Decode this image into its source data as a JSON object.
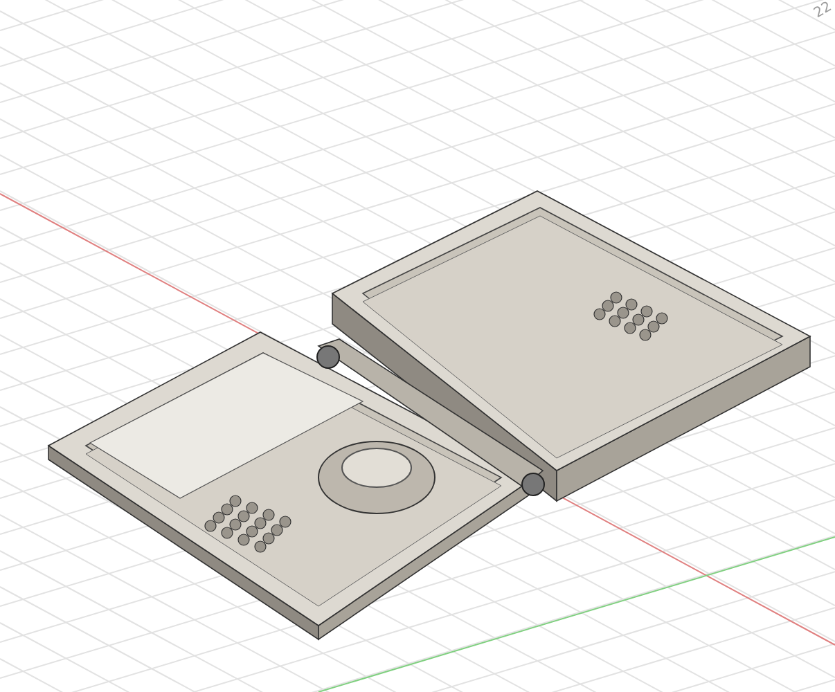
{
  "viewport": {
    "grid_label": "22"
  }
}
